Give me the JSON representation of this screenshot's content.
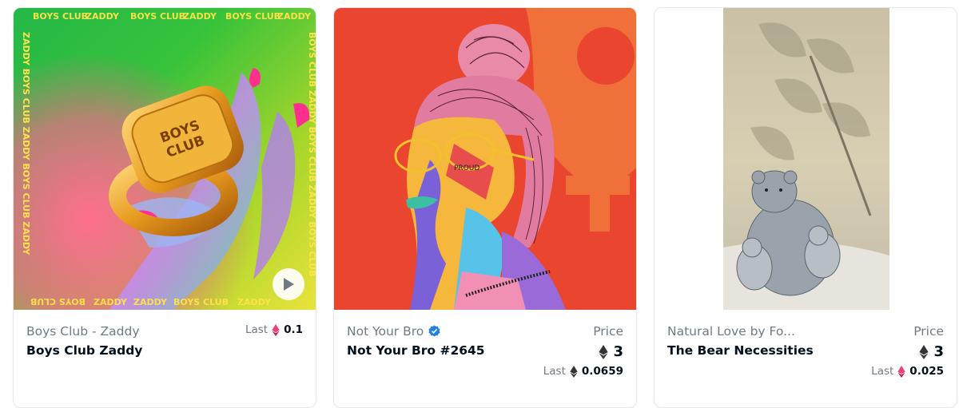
{
  "cards": [
    {
      "collection": "Boys Club - Zaddy",
      "name": "Boys Club Zaddy",
      "last_label": "Last",
      "last_value": "0.1",
      "last_currency_icon": "weth-icon",
      "has_play": true
    },
    {
      "collection": "Not Your Bro",
      "verified": true,
      "name": "Not Your Bro #2645",
      "price_label": "Price",
      "price_value": "3",
      "price_currency_icon": "eth-icon",
      "last_label": "Last",
      "last_value": "0.0659",
      "last_currency_icon": "eth-icon"
    },
    {
      "collection": "Natural Love by Fo...",
      "name": "The Bear Necessities",
      "price_label": "Price",
      "price_value": "3",
      "price_currency_icon": "eth-icon",
      "last_label": "Last",
      "last_value": "0.025",
      "last_currency_icon": "weth-icon"
    }
  ],
  "colors": {
    "muted_text": "#707a83",
    "primary_text": "#04111d",
    "verified_blue": "#2081e2",
    "weth_pink": "#ec407a"
  },
  "artwork_text": {
    "card1_ring": "BOYS CLUB",
    "card1_border": "BOYS CLUB ZADDY",
    "card2_glasses": "PROUD"
  }
}
